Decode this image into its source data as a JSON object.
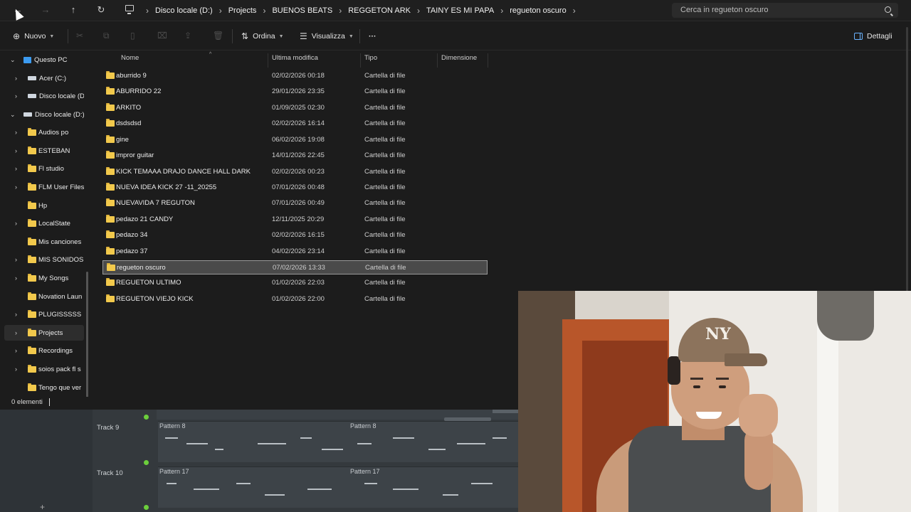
{
  "address": {
    "breadcrumbs": [
      "Disco locale (D:)",
      "Projects",
      "BUENOS BEATS",
      "REGGETON ARK",
      "TAINY ES MI PAPA",
      "regueton oscuro"
    ],
    "search_placeholder": "Cerca in regueton oscuro"
  },
  "toolbar": {
    "new_label": "Nuovo",
    "sort_label": "Ordina",
    "view_label": "Visualizza",
    "more_label": "···",
    "details_label": "Dettagli"
  },
  "sidebar": {
    "items": [
      {
        "label": "Questo PC",
        "icon": "pc-icon"
      },
      {
        "label": "Acer (C:)",
        "icon": "drive-icon"
      },
      {
        "label": "Disco locale (D",
        "icon": "drive-icon"
      },
      {
        "label": "Disco locale (D:)",
        "icon": "drive-icon"
      },
      {
        "label": "Audios po",
        "icon": "folder-icon"
      },
      {
        "label": "ESTEBAN",
        "icon": "folder-icon"
      },
      {
        "label": "Fl studio",
        "icon": "folder-icon"
      },
      {
        "label": "FLM User Files",
        "icon": "folder-icon"
      },
      {
        "label": "Hp",
        "icon": "folder-icon"
      },
      {
        "label": "LocalState",
        "icon": "folder-icon"
      },
      {
        "label": "Mis canciones",
        "icon": "folder-icon"
      },
      {
        "label": "MIS SONIDOS",
        "icon": "folder-icon"
      },
      {
        "label": "My Songs",
        "icon": "folder-icon"
      },
      {
        "label": "Novation Laun",
        "icon": "folder-icon"
      },
      {
        "label": "PLUGISSSSS",
        "icon": "folder-icon"
      },
      {
        "label": "Projects",
        "icon": "folder-icon"
      },
      {
        "label": "Recordings",
        "icon": "folder-icon"
      },
      {
        "label": "soios pack  fl s",
        "icon": "folder-icon"
      },
      {
        "label": "Tengo que ver",
        "icon": "folder-icon"
      }
    ]
  },
  "columns": {
    "name": "Nome",
    "modified": "Ultima modifica",
    "type": "Tipo",
    "size": "Dimensione"
  },
  "files": [
    {
      "name": "aburrido 9",
      "modified": "02/02/2026 00:18",
      "type": "Cartella di file"
    },
    {
      "name": "ABURRIDO 22",
      "modified": "29/01/2026 23:35",
      "type": "Cartella di file"
    },
    {
      "name": "ARKITO",
      "modified": "01/09/2025 02:30",
      "type": "Cartella di file"
    },
    {
      "name": "dsdsdsd",
      "modified": "02/02/2026 16:14",
      "type": "Cartella di file"
    },
    {
      "name": "gine",
      "modified": "06/02/2026 19:08",
      "type": "Cartella di file"
    },
    {
      "name": "impror  guitar",
      "modified": "14/01/2026 22:45",
      "type": "Cartella di file"
    },
    {
      "name": "KICK TEMAAA DRAJO DANCE HALL DARK",
      "modified": "02/02/2026 00:23",
      "type": "Cartella di file"
    },
    {
      "name": "NUEVA IDEA KICK 27 -11_20255",
      "modified": "07/01/2026 00:48",
      "type": "Cartella di file"
    },
    {
      "name": "NUEVAVIDA 7 REGUTON",
      "modified": "07/01/2026 00:49",
      "type": "Cartella di file"
    },
    {
      "name": "pedazo 21 CANDY",
      "modified": "12/11/2025 20:29",
      "type": "Cartella di file"
    },
    {
      "name": "pedazo 34",
      "modified": "02/02/2026 16:15",
      "type": "Cartella di file"
    },
    {
      "name": "pedazo 37",
      "modified": "04/02/2026 23:14",
      "type": "Cartella di file"
    },
    {
      "name": "regueton oscuro",
      "modified": "07/02/2026 13:33",
      "type": "Cartella di file",
      "selected": true
    },
    {
      "name": "REGUETON ULTIMO",
      "modified": "01/02/2026 22:03",
      "type": "Cartella di file"
    },
    {
      "name": "REGUETON VIEJO KICK",
      "modified": "01/02/2026 22:00",
      "type": "Cartella di file"
    }
  ],
  "status": {
    "count": "0 elementi"
  },
  "daw": {
    "tracks": [
      {
        "label": "Track 9",
        "clip": "Pattern 8"
      },
      {
        "label": "Track 10",
        "clip": "Pattern 17"
      }
    ]
  },
  "webcam": {
    "cap_logo": "NY"
  },
  "colors": {
    "accent": "#3c9bf0",
    "folder": "#f2c94c",
    "background": "#1c1c1c"
  }
}
